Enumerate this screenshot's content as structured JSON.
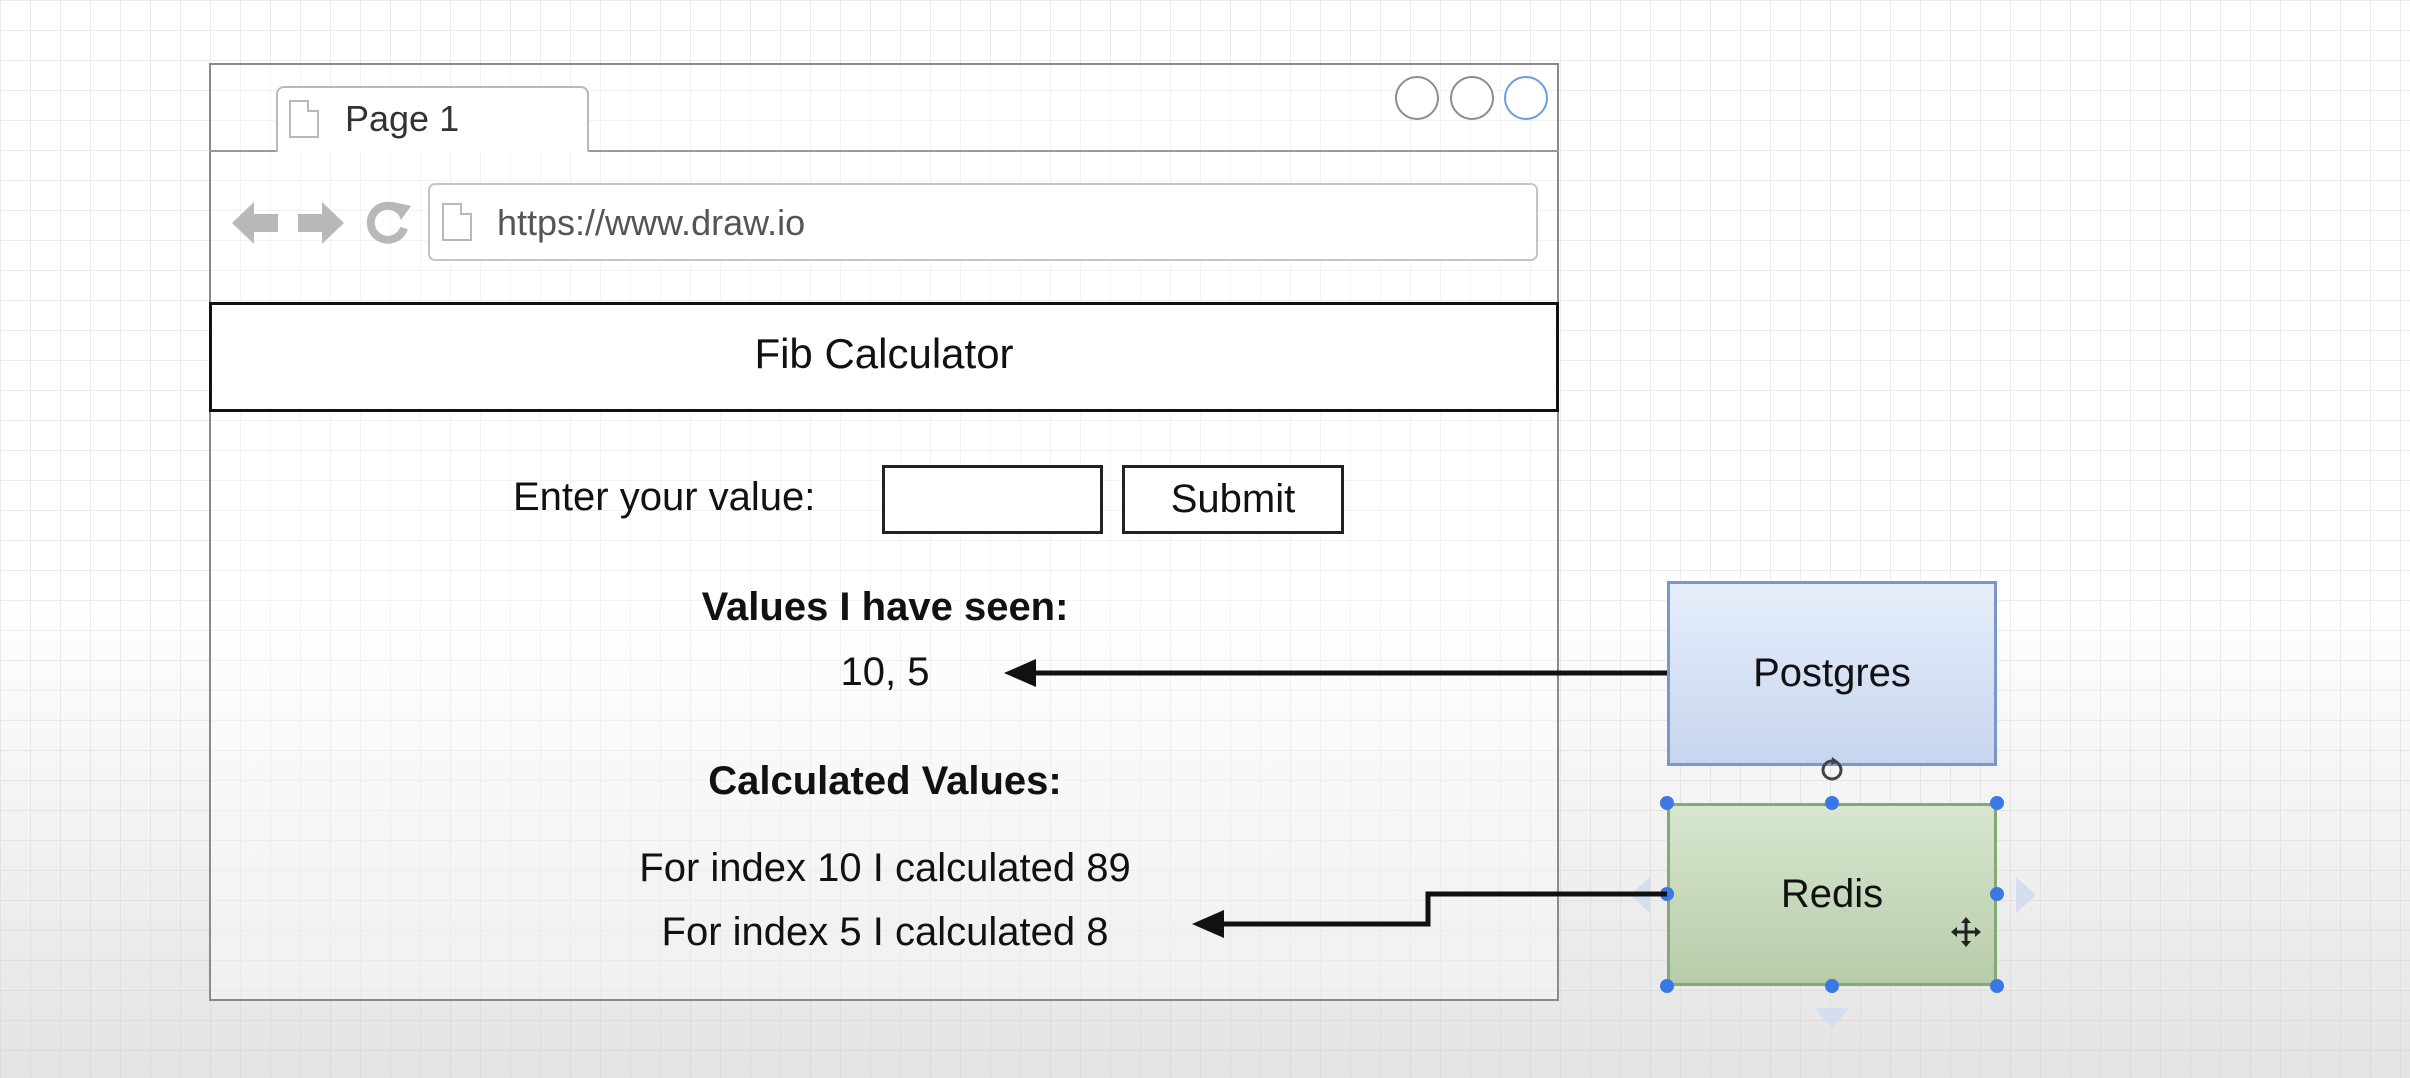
{
  "browser": {
    "tab_label": "Page 1",
    "url": "https://www.draw.io"
  },
  "app": {
    "title": "Fib Calculator",
    "input_label": "Enter your value:",
    "input_value": "",
    "submit_label": "Submit",
    "seen_heading": "Values I have seen:",
    "seen_values": "10, 5",
    "calculated_heading": "Calculated Values:",
    "calculated": [
      "For index 10 I calculated 89",
      "For index 5 I calculated 8"
    ]
  },
  "stores": {
    "postgres_label": "Postgres",
    "redis_label": "Redis"
  },
  "icons": [
    "page-icon",
    "back-arrow-icon",
    "forward-arrow-icon",
    "reload-icon",
    "rotate-handle-icon",
    "move-cursor-icon"
  ],
  "colors": {
    "postgres_border": "#7b97c9",
    "postgres_fill": "#dae4f7",
    "redis_border": "#83aa72",
    "redis_fill": "#c9dbbe",
    "selection_handle": "#3b78e7"
  }
}
